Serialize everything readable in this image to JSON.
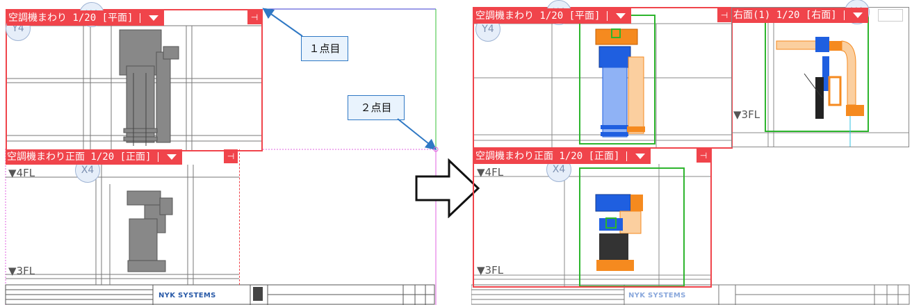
{
  "left": {
    "plan_title": "空調機まわり 1/20 [平面]",
    "front_title": "空調機まわり正面 1/20 [正面]",
    "grid_y": "Y4",
    "grid_x": "X4",
    "level_4fl": "▼4FL",
    "level_3fl": "▼3FL",
    "callout_1": "１点目",
    "callout_2": "２点目",
    "logo": "NYK SYSTEMS"
  },
  "right": {
    "plan_title": "空調機まわり 1/20 [平面]",
    "side_title": "右面(1) 1/20 [右面]",
    "front_title": "空調機まわり正面 1/20 [正面]",
    "grid_y": "Y4",
    "grid_x": "X4",
    "level_4fl": "▼4FL",
    "level_3fl_side": "▼3FL",
    "level_3fl_front": "▼3FL",
    "logo": "NYK SYSTEMS"
  },
  "colors": {
    "viewport_red": "#f0444b",
    "duct_blue": "#1f5fe0",
    "duct_orange": "#f58a1f",
    "pipe_green": "#2db52d",
    "callout_blue": "#2f78c4"
  },
  "icons": {
    "pin": "pin-icon",
    "dropdown": "dropdown-arrow-icon",
    "transition_arrow": "right-arrow-icon"
  }
}
